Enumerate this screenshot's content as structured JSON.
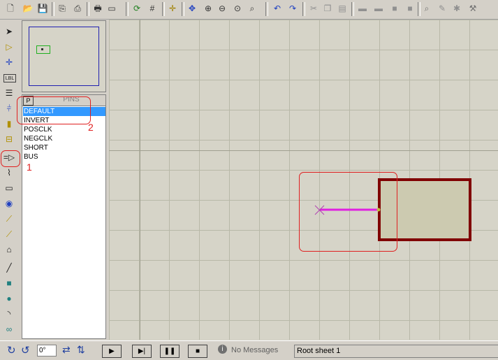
{
  "toolbar": {
    "icons": [
      "new-file",
      "open-folder",
      "save",
      "import",
      "export",
      "print",
      "print-area",
      "refresh",
      "grid",
      "origin",
      "pan",
      "zoom-in",
      "zoom-out",
      "zoom-all",
      "zoom-area",
      "undo",
      "redo",
      "cut",
      "copy",
      "paste",
      "block-copy",
      "block-move",
      "block-rotate",
      "block-delete",
      "pick-device",
      "make-device",
      "package-tool",
      "decompose"
    ]
  },
  "left_tools": [
    "selection",
    "component",
    "junction-dot",
    "wire-label",
    "text-script",
    "buses",
    "subcircuit",
    "terminals",
    "device-pins",
    "graph",
    "tape",
    "generator",
    "voltage-probe",
    "current-probe",
    "virtual-instruments",
    "line",
    "box",
    "circle",
    "arc",
    "path"
  ],
  "pins_panel": {
    "p_button": "P",
    "title": "PINS",
    "items": [
      {
        "label": "DEFAULT",
        "selected": true
      },
      {
        "label": "INVERT",
        "selected": false
      },
      {
        "label": "POSCLK",
        "selected": false
      },
      {
        "label": "NEGCLK",
        "selected": false
      },
      {
        "label": "SHORT",
        "selected": false
      },
      {
        "label": "BUS",
        "selected": false
      }
    ]
  },
  "annotations": {
    "one": "1",
    "two": "2"
  },
  "status": {
    "angle": "0°",
    "messages": "No Messages",
    "sheet": "Root sheet 1"
  },
  "colors": {
    "accent": "#3399ff",
    "pin": "#e020e0",
    "body": "#800000",
    "annotation": "#e02020"
  }
}
